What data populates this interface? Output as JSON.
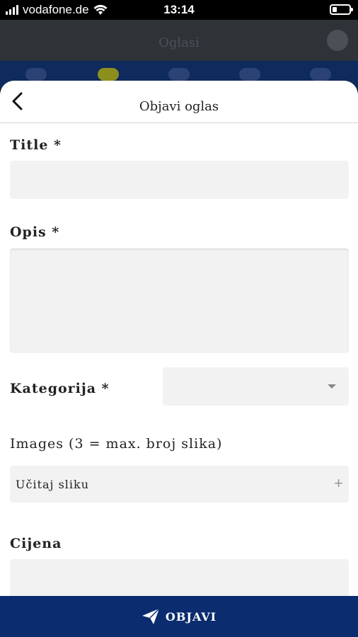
{
  "status_bar": {
    "carrier": "vodafone.de",
    "time": "13:14"
  },
  "app_bar": {
    "title": "Oglasi"
  },
  "sheet": {
    "title": "Objavi oglas"
  },
  "form": {
    "title_label": "Title *",
    "title_value": "",
    "description_label": "Opis *",
    "description_value": "",
    "category_label": "Kategorija *",
    "category_value": "",
    "images_label": "Images (3 = max. broj slika)",
    "upload_label": "Učitaj sliku",
    "upload_icon": "plus-icon",
    "price_label": "Cijena",
    "price_value": ""
  },
  "footer": {
    "submit_label": "OBJAVI",
    "submit_icon": "paper-plane-icon"
  },
  "colors": {
    "primary": "#0b2c6e",
    "field_bg": "#f2f2f2",
    "highlight": "#8c8f1e"
  }
}
